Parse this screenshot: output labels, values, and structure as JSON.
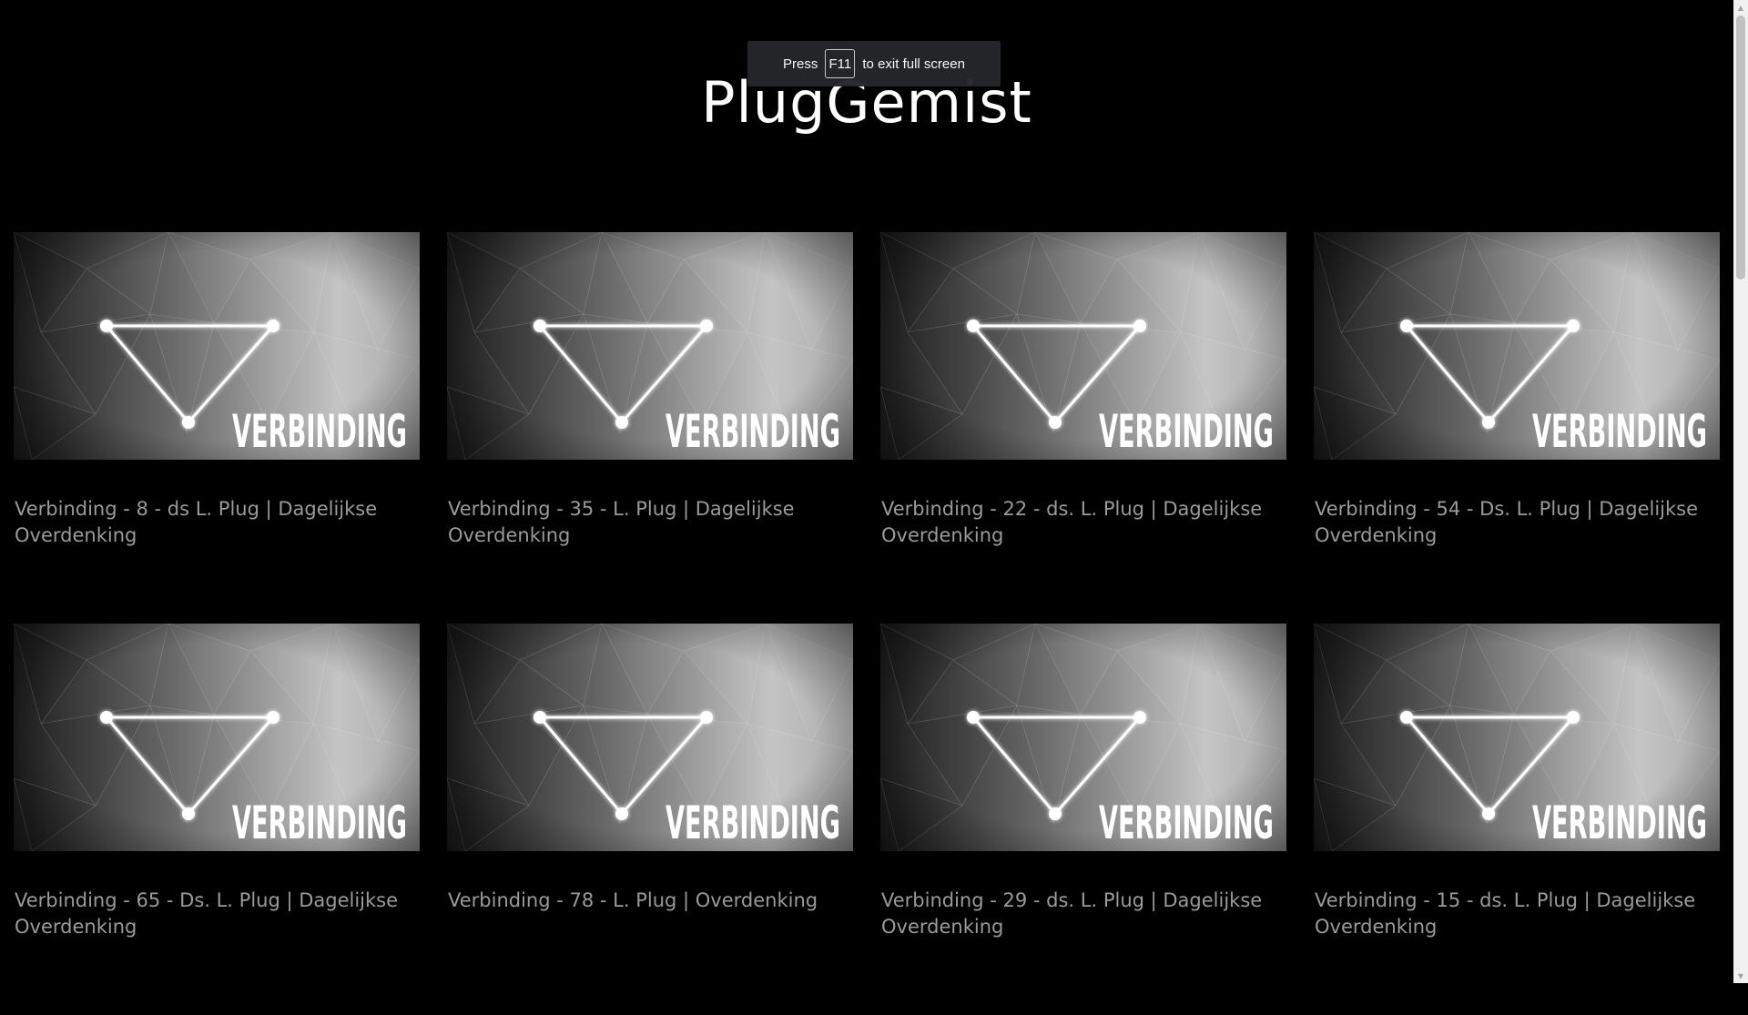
{
  "site": {
    "title": "PlugGemist"
  },
  "fullscreen_notice": {
    "before": "Press",
    "key": "F11",
    "after": "to exit full screen"
  },
  "thumbnail": {
    "label": "VERBINDING",
    "icon": "triangle-network-icon"
  },
  "episodes": [
    {
      "title": "Verbinding - 8 - ds L. Plug | Dagelijkse Overdenking"
    },
    {
      "title": "Verbinding - 35 - L. Plug | Dagelijkse Overdenking"
    },
    {
      "title": "Verbinding - 22 - ds. L. Plug | Dagelijkse Overdenking"
    },
    {
      "title": "Verbinding - 54 - Ds. L. Plug | Dagelijkse Overdenking"
    },
    {
      "title": "Verbinding - 65 - Ds. L. Plug | Dagelijkse Overdenking"
    },
    {
      "title": "Verbinding - 78 - L. Plug | Overdenking"
    },
    {
      "title": "Verbinding - 29 - ds. L. Plug | Dagelijkse Overdenking"
    },
    {
      "title": "Verbinding - 15 - ds. L. Plug | Dagelijkse Overdenking"
    }
  ],
  "colors": {
    "background": "#000000",
    "title": "#ffffff",
    "card_text": "#9a9a9a"
  }
}
